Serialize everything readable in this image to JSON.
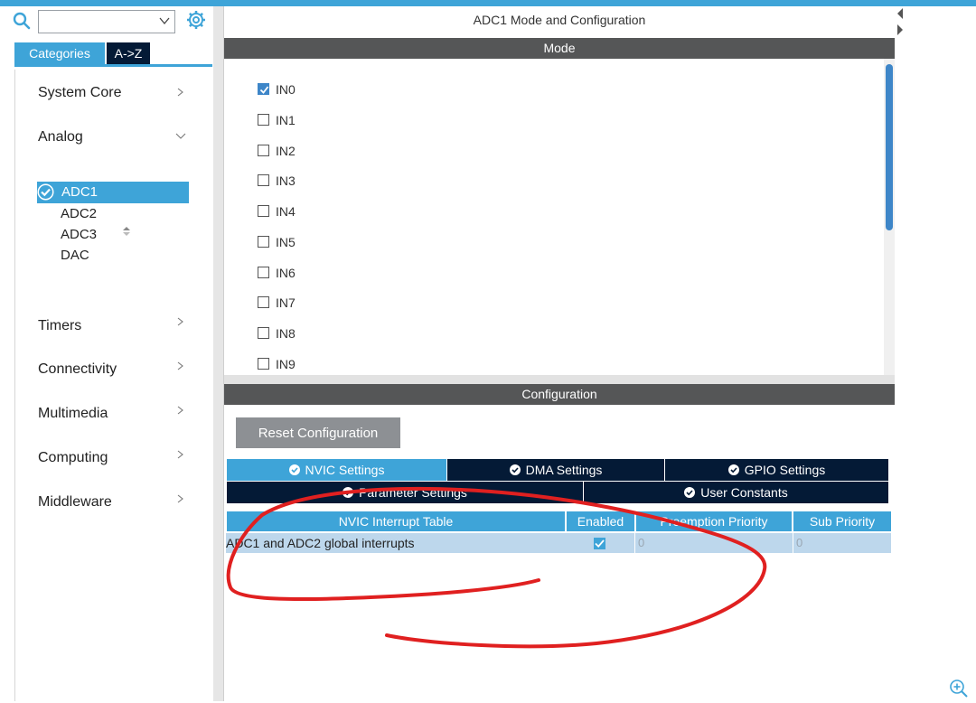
{
  "left": {
    "search": {
      "value": "",
      "placeholder": ""
    },
    "tabs": [
      "Categories",
      "A->Z"
    ],
    "categories": [
      {
        "label": "System Core",
        "expanded": false
      },
      {
        "label": "Analog",
        "expanded": true
      },
      {
        "label": "Timers",
        "expanded": false
      },
      {
        "label": "Connectivity",
        "expanded": false
      },
      {
        "label": "Multimedia",
        "expanded": false
      },
      {
        "label": "Computing",
        "expanded": false
      },
      {
        "label": "Middleware",
        "expanded": false
      }
    ],
    "analog_items": [
      "ADC1",
      "ADC2",
      "ADC3",
      "DAC"
    ],
    "selected_item": "ADC1"
  },
  "main": {
    "title": "ADC1 Mode and Configuration",
    "mode_header": "Mode",
    "mode_items": [
      {
        "label": "IN0",
        "checked": true
      },
      {
        "label": "IN1",
        "checked": false
      },
      {
        "label": "IN2",
        "checked": false
      },
      {
        "label": "IN3",
        "checked": false
      },
      {
        "label": "IN4",
        "checked": false
      },
      {
        "label": "IN5",
        "checked": false
      },
      {
        "label": "IN6",
        "checked": false
      },
      {
        "label": "IN7",
        "checked": false
      },
      {
        "label": "IN8",
        "checked": false
      },
      {
        "label": "IN9",
        "checked": false
      }
    ],
    "config_header": "Configuration",
    "reset_button": "Reset Configuration",
    "settings_tabs": [
      {
        "label": "NVIC Settings",
        "active": true
      },
      {
        "label": "DMA Settings",
        "active": false
      },
      {
        "label": "GPIO Settings",
        "active": false
      },
      {
        "label": "Parameter Settings",
        "active": false
      },
      {
        "label": "User Constants",
        "active": false
      }
    ],
    "nvic_table": {
      "headers": [
        "NVIC Interrupt Table",
        "Enabled",
        "Preemption Priority",
        "Sub Priority"
      ],
      "rows": [
        {
          "name": "ADC1 and ADC2 global interrupts",
          "enabled": true,
          "preemption": "0",
          "sub": "0"
        }
      ]
    }
  },
  "colors": {
    "accent": "#3ea4d8",
    "navy": "#041a36",
    "header_gray": "#555657",
    "annotation": "#e02020"
  }
}
